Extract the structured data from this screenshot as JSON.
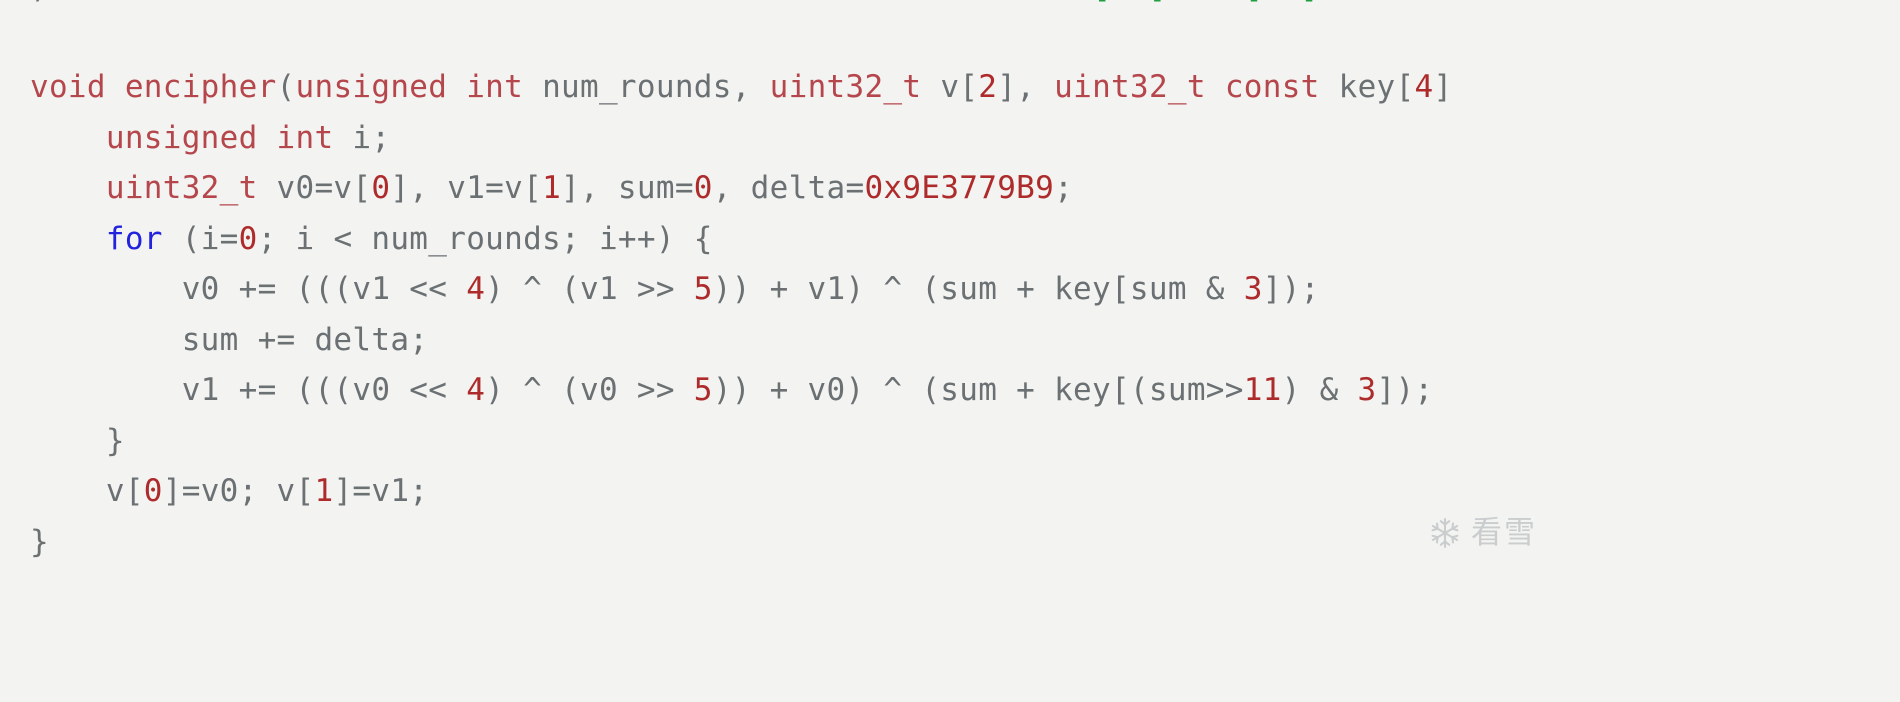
{
  "page": {
    "background_color": "#f3f3f2",
    "kind": "code-listing-screenshot"
  },
  "colors": {
    "background": "#f3f3f2",
    "identifier": "#6b7073",
    "type_keyword": "#b5474c",
    "control_keyword": "#2323dd",
    "number_literal": "#ae2b2b",
    "clipped_bracket_green": "#1e9e3e",
    "watermark": "#9aa0a3"
  },
  "code": {
    "language": "C",
    "clipped_top_line": {
      "visible": "partially clipped — only glyph bottoms of brackets visible",
      "fragments": [
        "[ ]",
        "[ ]",
        "] [ ]",
        "] [ ]"
      ]
    },
    "lines": [
      {
        "indent": 0,
        "tokens": [
          {
            "t": "void",
            "c": "type"
          },
          {
            "t": " ",
            "c": "plain"
          },
          {
            "t": "encipher",
            "c": "type"
          },
          {
            "t": "(",
            "c": "plain"
          },
          {
            "t": "unsigned",
            "c": "type"
          },
          {
            "t": " ",
            "c": "plain"
          },
          {
            "t": "int",
            "c": "type"
          },
          {
            "t": " num_rounds, ",
            "c": "plain"
          },
          {
            "t": "uint32_t",
            "c": "type"
          },
          {
            "t": " v[",
            "c": "plain"
          },
          {
            "t": "2",
            "c": "num"
          },
          {
            "t": "], ",
            "c": "plain"
          },
          {
            "t": "uint32_t",
            "c": "type"
          },
          {
            "t": " ",
            "c": "plain"
          },
          {
            "t": "const",
            "c": "type"
          },
          {
            "t": " key[",
            "c": "plain"
          },
          {
            "t": "4",
            "c": "num"
          },
          {
            "t": "]",
            "c": "plain"
          }
        ]
      },
      {
        "indent": 1,
        "tokens": [
          {
            "t": "unsigned",
            "c": "type"
          },
          {
            "t": " ",
            "c": "plain"
          },
          {
            "t": "int",
            "c": "type"
          },
          {
            "t": " i;",
            "c": "plain"
          }
        ]
      },
      {
        "indent": 1,
        "tokens": [
          {
            "t": "uint32_t",
            "c": "type"
          },
          {
            "t": " v0=v[",
            "c": "plain"
          },
          {
            "t": "0",
            "c": "num"
          },
          {
            "t": "], v1=v[",
            "c": "plain"
          },
          {
            "t": "1",
            "c": "num"
          },
          {
            "t": "], sum=",
            "c": "plain"
          },
          {
            "t": "0",
            "c": "num"
          },
          {
            "t": ", delta=",
            "c": "plain"
          },
          {
            "t": "0x9E3779B9",
            "c": "num"
          },
          {
            "t": ";",
            "c": "plain"
          }
        ]
      },
      {
        "indent": 1,
        "tokens": [
          {
            "t": "for",
            "c": "kw"
          },
          {
            "t": " (i=",
            "c": "plain"
          },
          {
            "t": "0",
            "c": "num"
          },
          {
            "t": "; i < num_rounds; i++) {",
            "c": "plain"
          }
        ]
      },
      {
        "indent": 2,
        "tokens": [
          {
            "t": "v0 += (((v1 << ",
            "c": "plain"
          },
          {
            "t": "4",
            "c": "num"
          },
          {
            "t": ") ^ (v1 >> ",
            "c": "plain"
          },
          {
            "t": "5",
            "c": "num"
          },
          {
            "t": ")) + v1) ^ (sum + key[sum & ",
            "c": "plain"
          },
          {
            "t": "3",
            "c": "num"
          },
          {
            "t": "]);",
            "c": "plain"
          }
        ]
      },
      {
        "indent": 2,
        "tokens": [
          {
            "t": "sum += delta;",
            "c": "plain"
          }
        ]
      },
      {
        "indent": 2,
        "tokens": [
          {
            "t": "v1 += (((v0 << ",
            "c": "plain"
          },
          {
            "t": "4",
            "c": "num"
          },
          {
            "t": ") ^ (v0 >> ",
            "c": "plain"
          },
          {
            "t": "5",
            "c": "num"
          },
          {
            "t": ")) + v0) ^ (sum + key[(sum>>",
            "c": "plain"
          },
          {
            "t": "11",
            "c": "num"
          },
          {
            "t": ") & ",
            "c": "plain"
          },
          {
            "t": "3",
            "c": "num"
          },
          {
            "t": "]);",
            "c": "plain"
          }
        ]
      },
      {
        "indent": 1,
        "tokens": [
          {
            "t": "}",
            "c": "plain"
          }
        ]
      },
      {
        "indent": 1,
        "tokens": [
          {
            "t": "v[",
            "c": "plain"
          },
          {
            "t": "0",
            "c": "num"
          },
          {
            "t": "]=v0; v[",
            "c": "plain"
          },
          {
            "t": "1",
            "c": "num"
          },
          {
            "t": "]=v1;",
            "c": "plain"
          }
        ]
      },
      {
        "indent": 0,
        "tokens": [
          {
            "t": "}",
            "c": "plain"
          }
        ]
      }
    ],
    "plain_text": "void encipher(unsigned int num_rounds, uint32_t v[2], uint32_t const key[4]\n    unsigned int i;\n    uint32_t v0=v[0], v1=v[1], sum=0, delta=0x9E3779B9;\n    for (i=0; i < num_rounds; i++) {\n        v0 += (((v1 << 4) ^ (v1 >> 5)) + v1) ^ (sum + key[sum & 3]);\n        sum += delta;\n        v1 += (((v0 << 4) ^ (v0 >> 5)) + v0) ^ (sum + key[(sum>>11) & 3]);\n    }\n    v[0]=v0; v[1]=v1;\n}"
  },
  "watermark": {
    "icon": "snowflake-icon",
    "text": "看雪"
  }
}
